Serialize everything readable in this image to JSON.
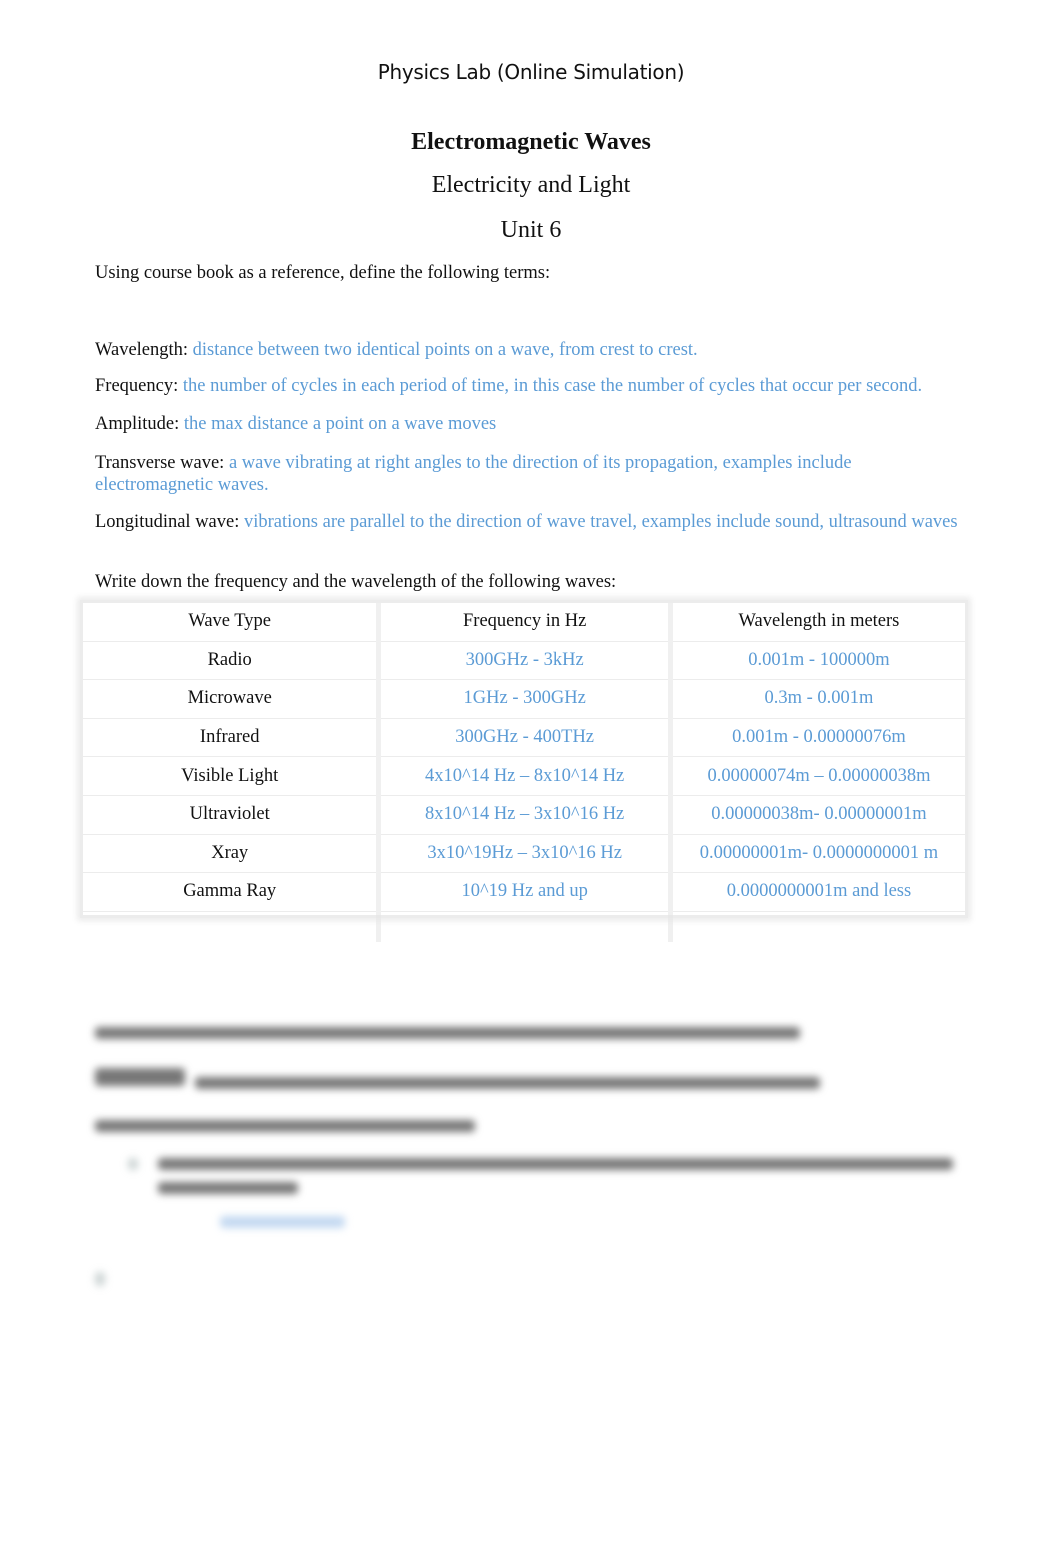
{
  "header": {
    "title": "Physics Lab (Online Simulation)"
  },
  "document": {
    "title": "Electromagnetic Waves",
    "subtitle": "Electricity and Light",
    "unit": "Unit 6",
    "intro": "Using course book as a reference, define the following terms:",
    "definitions": [
      {
        "term": "Wavelength:",
        "answer": "distance between two identical points on a wave, from crest to crest."
      },
      {
        "term": "Frequency:",
        "answer": "the number of cycles in each period of time, in this case the number of cycles that occur per second."
      },
      {
        "term": "Amplitude:",
        "answer": "the max distance a point on a wave moves"
      },
      {
        "term": "Transverse wave:",
        "answer": "a wave vibrating at right angles to the direction of its propagation, examples include electromagnetic waves."
      },
      {
        "term": "Longitudinal wave:",
        "answer": "vibrations are parallel to the direction of wave travel, examples include sound, ultrasound waves"
      }
    ],
    "table_intro": "Write down the frequency and the wavelength of the following waves:",
    "table": {
      "headers": [
        "Wave Type",
        "Frequency in Hz",
        "Wavelength in meters"
      ],
      "rows": [
        [
          "Radio",
          "300GHz - 3kHz",
          "0.001m - 100000m"
        ],
        [
          "Microwave",
          "1GHz - 300GHz",
          "0.3m - 0.001m"
        ],
        [
          "Infrared",
          "300GHz - 400THz",
          "0.001m - 0.00000076m"
        ],
        [
          "Visible Light",
          "4x10^14 Hz – 8x10^14 Hz",
          "0.00000074m – 0.00000038m"
        ],
        [
          "Ultraviolet",
          "8x10^14 Hz – 3x10^16 Hz",
          "0.00000038m- 0.00000001m"
        ],
        [
          "Xray",
          "3x10^19Hz – 3x10^16 Hz",
          "0.00000001m- 0.0000000001 m"
        ],
        [
          "Gamma Ray",
          "10^19 Hz and up",
          "0.0000000001m and less"
        ],
        [
          "",
          "",
          ""
        ]
      ]
    }
  },
  "colors": {
    "answer": "#5b9bd5",
    "text": "#111111"
  }
}
